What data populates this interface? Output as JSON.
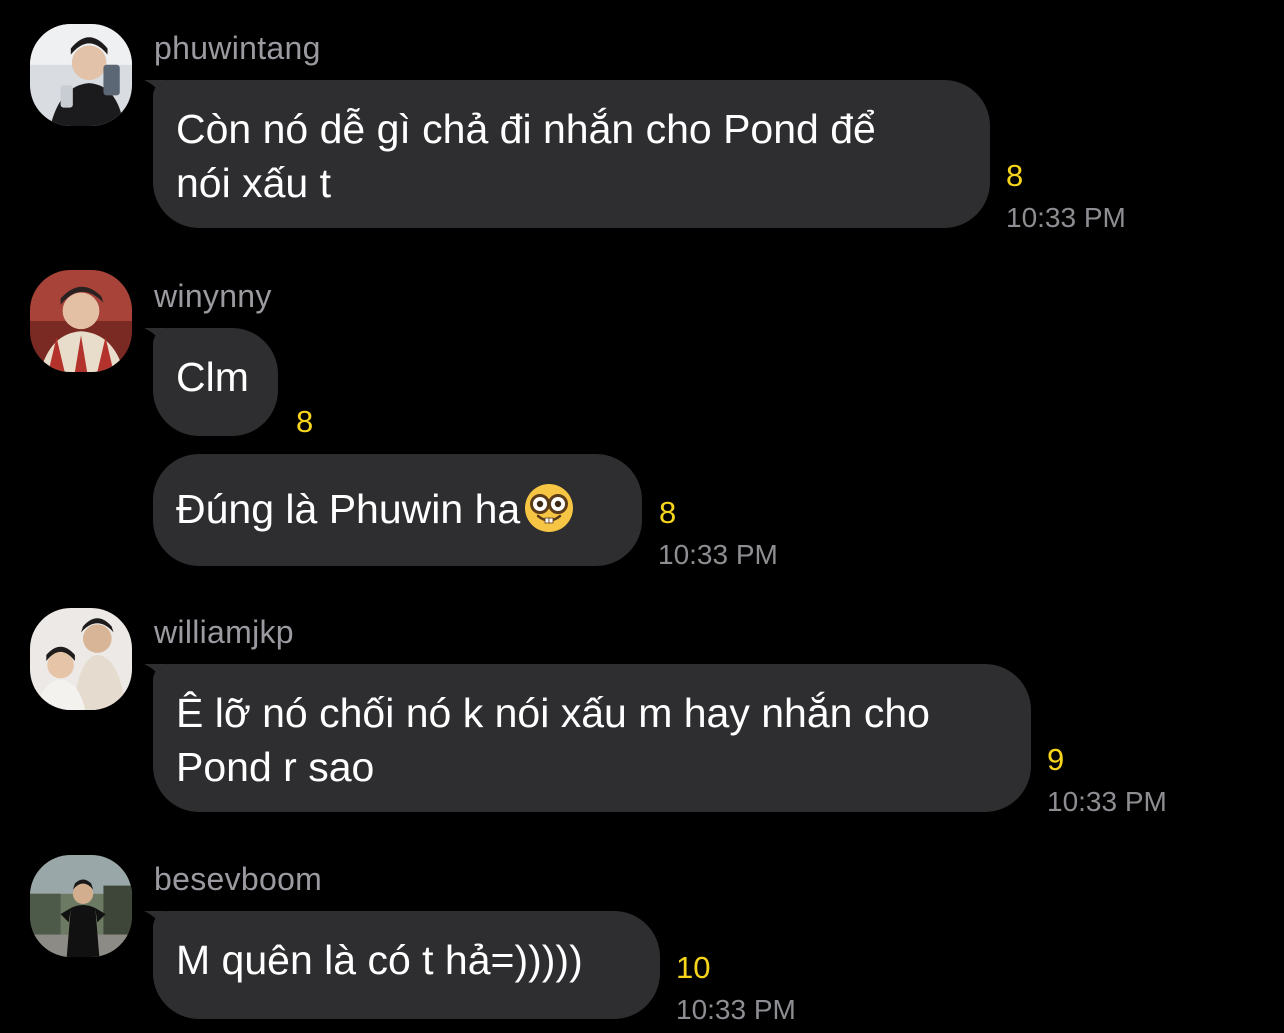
{
  "messages": [
    {
      "username": "phuwintang",
      "lines": [
        "Còn nó dễ gì chả đi nhắn cho Pond để",
        "nói xấu t"
      ],
      "count": "8",
      "time": "10:33 PM"
    },
    {
      "username": "winynny",
      "text": "Clm",
      "count": "8"
    },
    {
      "text": "Đúng là Phuwin ha",
      "emoji": "nerd-face-emoji",
      "count": "8",
      "time": "10:33 PM"
    },
    {
      "username": "williamjkp",
      "lines": [
        "Ê lỡ nó chối nó k nói xấu m hay nhắn cho",
        "Pond r sao"
      ],
      "count": "9",
      "time": "10:33 PM"
    },
    {
      "username": "besevboom",
      "text": "M quên là có t hả=)))))",
      "count": "10",
      "time": "10:33 PM"
    }
  ],
  "colors": {
    "background": "#000000",
    "bubble": "#2e2e30",
    "username": "#9a9aa0",
    "count": "#f7d51d",
    "time": "#8d8d92"
  }
}
